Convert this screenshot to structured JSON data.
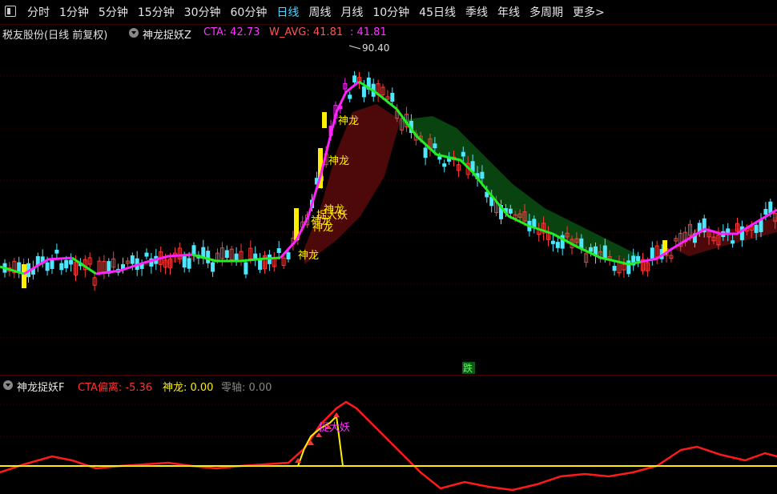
{
  "toolbar": {
    "tabs": [
      {
        "label": "分时"
      },
      {
        "label": "1分钟"
      },
      {
        "label": "5分钟"
      },
      {
        "label": "15分钟"
      },
      {
        "label": "30分钟"
      },
      {
        "label": "60分钟"
      },
      {
        "label": "日线",
        "active": true
      },
      {
        "label": "周线"
      },
      {
        "label": "月线"
      },
      {
        "label": "10分钟"
      },
      {
        "label": "45日线"
      },
      {
        "label": "季线"
      },
      {
        "label": "年线"
      },
      {
        "label": "多周期"
      },
      {
        "label": "更多>"
      }
    ]
  },
  "main_header": {
    "stock": "税友股份(日线 前复权)",
    "indicator": "神龙捉妖Z",
    "cta": "CTA: 42.73",
    "w_avg": "W_AVG: 41.81",
    "w_avg_value": ": 41.81"
  },
  "sub_header": {
    "indicator": "神龙捉妖F",
    "cta_dev": "CTA偏离: -5.36",
    "shenlong": "神龙: 0.00",
    "zero_axis": "零轴: 0.00"
  },
  "main_chart": {
    "price_high_label": "90.40",
    "signal_labels": [
      "神龙",
      "神龙",
      "神龙",
      "神龙",
      "捉大妖",
      "神龙",
      "神龙"
    ],
    "drop_label": "跌"
  },
  "sub_chart": {
    "signal_label": "捉大妖"
  },
  "colors": {
    "up": "#ff3b3b",
    "down": "#4de8ff",
    "signal": "#ffee00",
    "trend_up": "#ff22ff",
    "trend_down": "#22ee22",
    "band_up": "#5a0a0a",
    "band_down": "#0a4a12",
    "sub_line": "#ff1a1a"
  }
}
